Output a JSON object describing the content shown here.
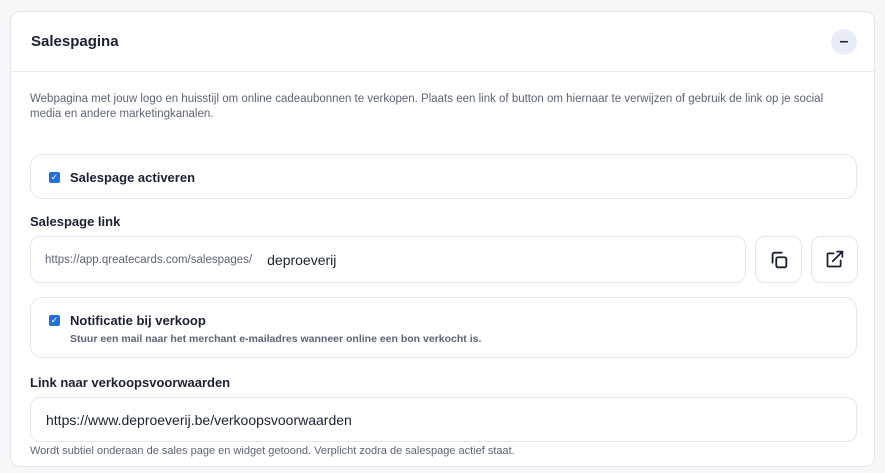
{
  "header": {
    "title": "Salespagina",
    "collapse_symbol": "–"
  },
  "description": "Webpagina met jouw logo en huisstijl om online cadeaubonnen te verkopen. Plaats een link of button om hiernaar te verwijzen of gebruik de link op je social media en andere marketingkanalen.",
  "activate": {
    "label": "Salespage activeren",
    "checked": true
  },
  "salespage_link": {
    "label": "Salespage link",
    "prefix": "https://app.qreatecards.com/salespages/",
    "value": "deproeverij",
    "copy_icon": "copy-icon",
    "open_icon": "external-link-icon"
  },
  "notification": {
    "label": "Notificatie bij verkoop",
    "description": "Stuur een mail naar het merchant e-mailadres wanneer online een bon verkocht is.",
    "checked": true
  },
  "terms_link": {
    "label": "Link naar verkoopsvoorwaarden",
    "value": "https://www.deproeverij.be/verkoopsvoorwaarden",
    "hint": "Wordt subtiel onderaan de sales page en widget getoond. Verplicht zodra de salespage actief staat."
  },
  "colors": {
    "checkbox": "#1f6fe5",
    "collapse_bg": "#e9edf7"
  }
}
